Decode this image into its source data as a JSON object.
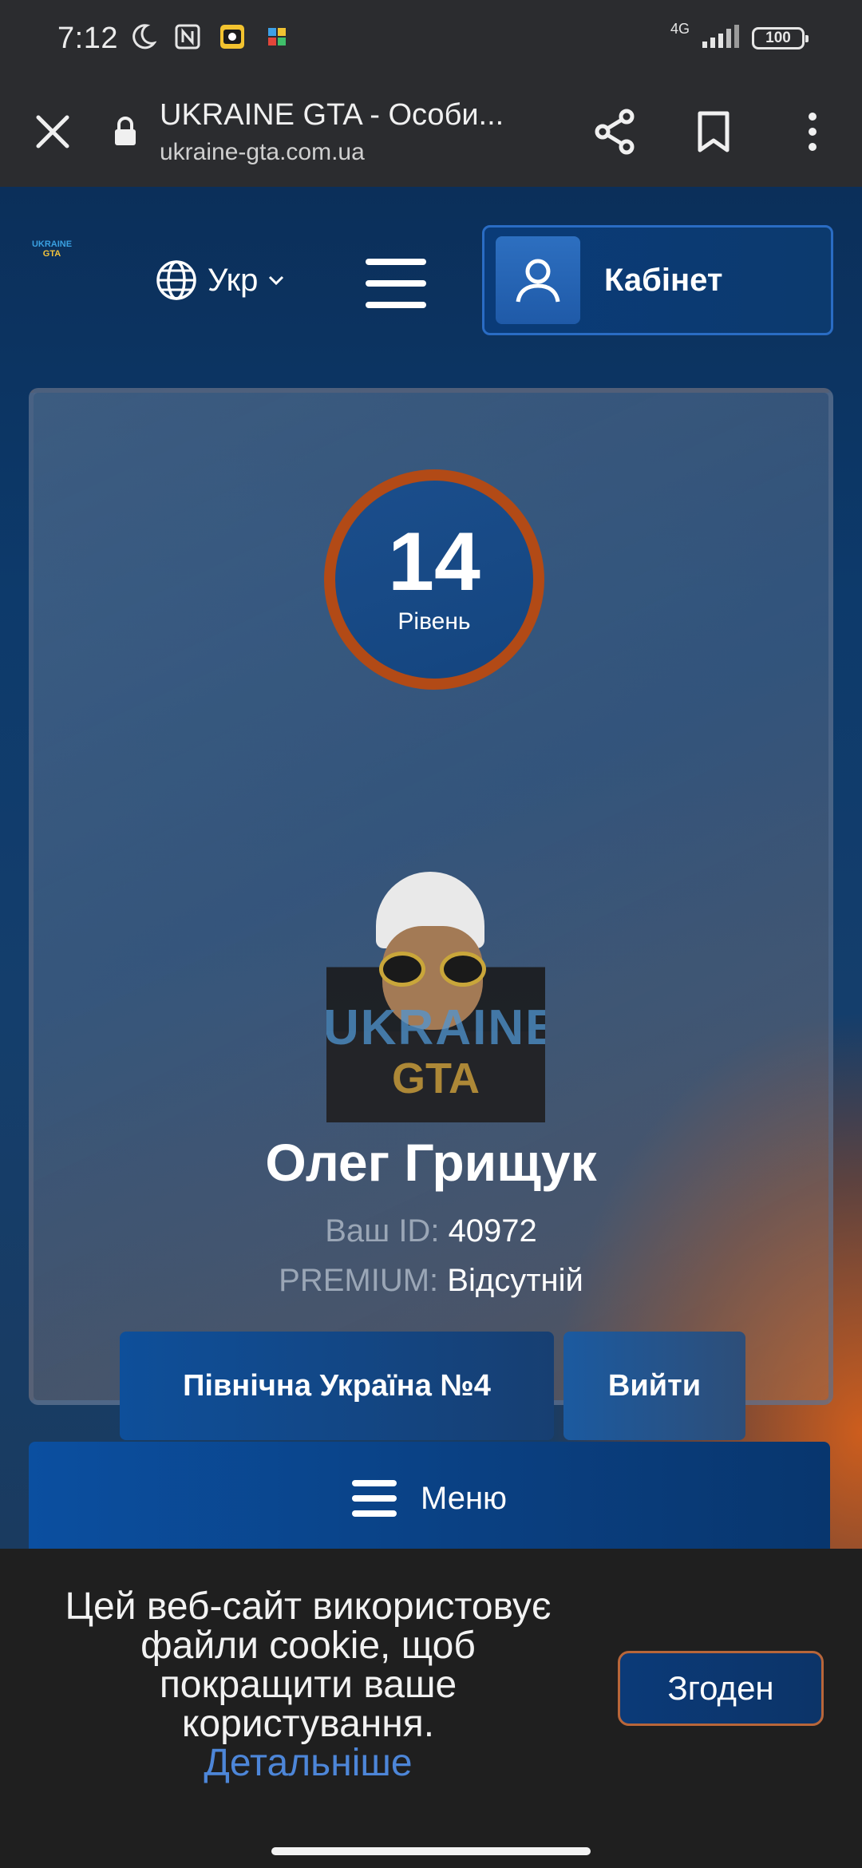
{
  "status_bar": {
    "time": "7:12",
    "network": "4G",
    "battery": "100",
    "icons": [
      "moon-icon",
      "nfc-icon",
      "app-notification-icon",
      "puzzle-app-icon",
      "signal-icon"
    ]
  },
  "browser": {
    "page_title": "UKRAINE GTA - Особи...",
    "url": "ukraine-gta.com.ua",
    "icons": [
      "close-icon",
      "lock-icon",
      "share-icon",
      "bookmark-icon",
      "more-vert-icon"
    ]
  },
  "header": {
    "logo_line1": "UKRAINE",
    "logo_line2": "GTA",
    "language": "Укр",
    "cabinet_label": "Кабінет"
  },
  "profile": {
    "level": "14",
    "level_label": "Рівень",
    "avatar_watermark_1": "UKRAINE",
    "avatar_watermark_2": "GTA",
    "name": "Олег Грищук",
    "id_label": "Ваш ID:",
    "id_value": "40972",
    "premium_label": "PREMIUM:",
    "premium_value": "Відсутній",
    "server_button": "Північна Україна №4",
    "logout_button": "Вийти"
  },
  "menu": {
    "label": "Меню"
  },
  "cookie": {
    "text": "Цей веб-сайт використовує файли cookie, щоб покращити ваше користування.",
    "link": "Детальніше",
    "agree": "Згоден"
  },
  "colors": {
    "accent_blue": "#0b4fa0",
    "level_ring": "#b24a16",
    "link": "#4d86d8"
  }
}
